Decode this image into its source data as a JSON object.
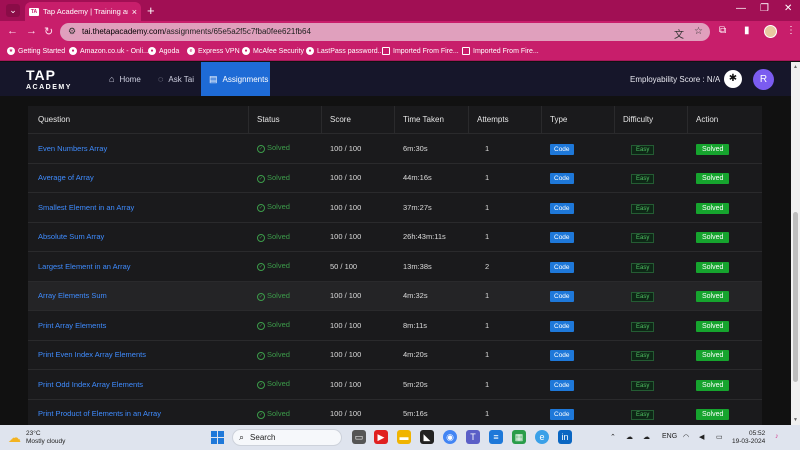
{
  "browser": {
    "tab_title": "Tap Academy | Training and Pla",
    "tab_favicon": "TA",
    "url_domain": "tai.thetapacademy.com",
    "url_path": "/assignments/65e5a2f5c7fba0fee621fb64",
    "bookmarks": [
      "Getting Started",
      "Amazon.co.uk - Onli...",
      "Agoda",
      "Express VPN",
      "McAfee Security",
      "LastPass password...",
      "Imported From Fire...",
      "Imported From Fire..."
    ]
  },
  "app": {
    "logo_line1": "TAP",
    "logo_line2": "ACADEMY",
    "nav": [
      "Home",
      "Ask Tai",
      "Assignments"
    ],
    "employability": "Employability Score : N/A",
    "user_initial": "R"
  },
  "table": {
    "headers": [
      "Question",
      "Status",
      "Score",
      "Time Taken",
      "Attempts",
      "Type",
      "Difficulty",
      "Action"
    ],
    "rows": [
      {
        "q": "Even Numbers Array",
        "status": "Solved",
        "score": "100 / 100",
        "time": "6m:30s",
        "attempts": "1",
        "type": "Code",
        "difficulty": "Easy",
        "action": "Solved"
      },
      {
        "q": "Average of Array",
        "status": "Solved",
        "score": "100 / 100",
        "time": "44m:16s",
        "attempts": "1",
        "type": "Code",
        "difficulty": "Easy",
        "action": "Solved"
      },
      {
        "q": "Smallest Element in an Array",
        "status": "Solved",
        "score": "100 / 100",
        "time": "37m:27s",
        "attempts": "1",
        "type": "Code",
        "difficulty": "Easy",
        "action": "Solved"
      },
      {
        "q": "Absolute Sum Array",
        "status": "Solved",
        "score": "100 / 100",
        "time": "26h:43m:11s",
        "attempts": "1",
        "type": "Code",
        "difficulty": "Easy",
        "action": "Solved"
      },
      {
        "q": "Largest Element in an Array",
        "status": "Solved",
        "score": "50 / 100",
        "time": "13m:38s",
        "attempts": "2",
        "type": "Code",
        "difficulty": "Easy",
        "action": "Solved"
      },
      {
        "q": "Array Elements Sum",
        "status": "Solved",
        "score": "100 / 100",
        "time": "4m:32s",
        "attempts": "1",
        "type": "Code",
        "difficulty": "Easy",
        "action": "Solved"
      },
      {
        "q": "Print Array Elements",
        "status": "Solved",
        "score": "100 / 100",
        "time": "8m:11s",
        "attempts": "1",
        "type": "Code",
        "difficulty": "Easy",
        "action": "Solved"
      },
      {
        "q": "Print Even Index Array Elements",
        "status": "Solved",
        "score": "100 / 100",
        "time": "4m:20s",
        "attempts": "1",
        "type": "Code",
        "difficulty": "Easy",
        "action": "Solved"
      },
      {
        "q": "Print Odd Index Array Elements",
        "status": "Solved",
        "score": "100 / 100",
        "time": "5m:20s",
        "attempts": "1",
        "type": "Code",
        "difficulty": "Easy",
        "action": "Solved"
      },
      {
        "q": "Print Product of Elements in an Array",
        "status": "Solved",
        "score": "100 / 100",
        "time": "5m:16s",
        "attempts": "1",
        "type": "Code",
        "difficulty": "Easy",
        "action": "Solved"
      }
    ]
  },
  "taskbar": {
    "temp": "23°C",
    "weather": "Mostly cloudy",
    "search": "Search",
    "lang": "ENG",
    "time": "05:52",
    "date": "19-03-2024"
  },
  "colors": {
    "chrome": "#c81e6b",
    "header": "#16162a",
    "accent": "#1e6bd6",
    "solved": "#16a42e"
  }
}
